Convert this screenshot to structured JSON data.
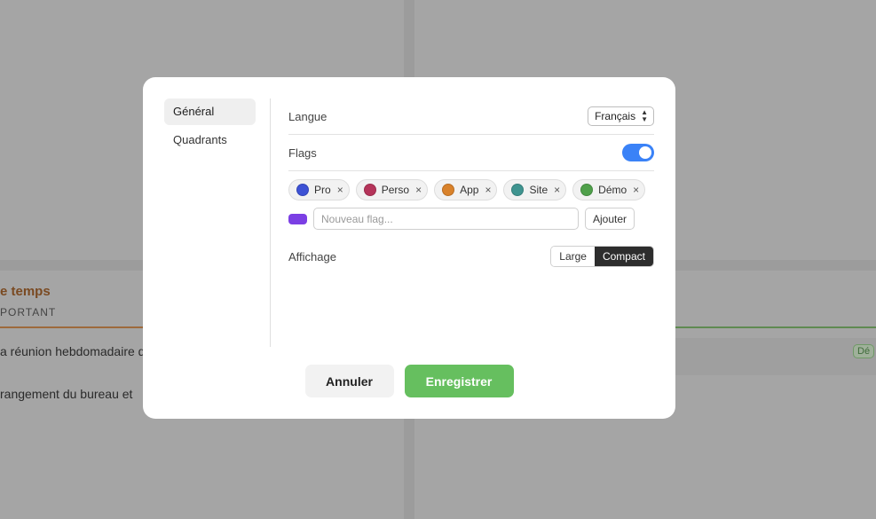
{
  "background": {
    "section_title": "e temps",
    "section_subtitle": "PORTANT",
    "tasks": [
      "a réunion hebdomadaire d",
      "rangement du bureau et"
    ],
    "badge": "Dé"
  },
  "sidebar": {
    "items": [
      {
        "label": "Général",
        "active": true
      },
      {
        "label": "Quadrants",
        "active": false
      }
    ]
  },
  "settings": {
    "language": {
      "label": "Langue",
      "value": "Français"
    },
    "flags_toggle": {
      "label": "Flags",
      "enabled": true
    },
    "flags": [
      {
        "name": "Pro",
        "color": "#3d52d5"
      },
      {
        "name": "Perso",
        "color": "#b5345a"
      },
      {
        "name": "App",
        "color": "#d9822b"
      },
      {
        "name": "Site",
        "color": "#3f9490"
      },
      {
        "name": "Démo",
        "color": "#4fa04a"
      }
    ],
    "new_flag": {
      "swatch_color": "#7b3fe4",
      "placeholder": "Nouveau flag...",
      "value": "",
      "add_label": "Ajouter"
    },
    "display": {
      "label": "Affichage",
      "options": [
        "Large",
        "Compact"
      ],
      "selected": "Compact"
    }
  },
  "footer": {
    "cancel_label": "Annuler",
    "save_label": "Enregistrer"
  },
  "colors": {
    "toggle_on": "#3a82f7",
    "save_button": "#66bf5f",
    "segment_active": "#2d2d2d"
  }
}
